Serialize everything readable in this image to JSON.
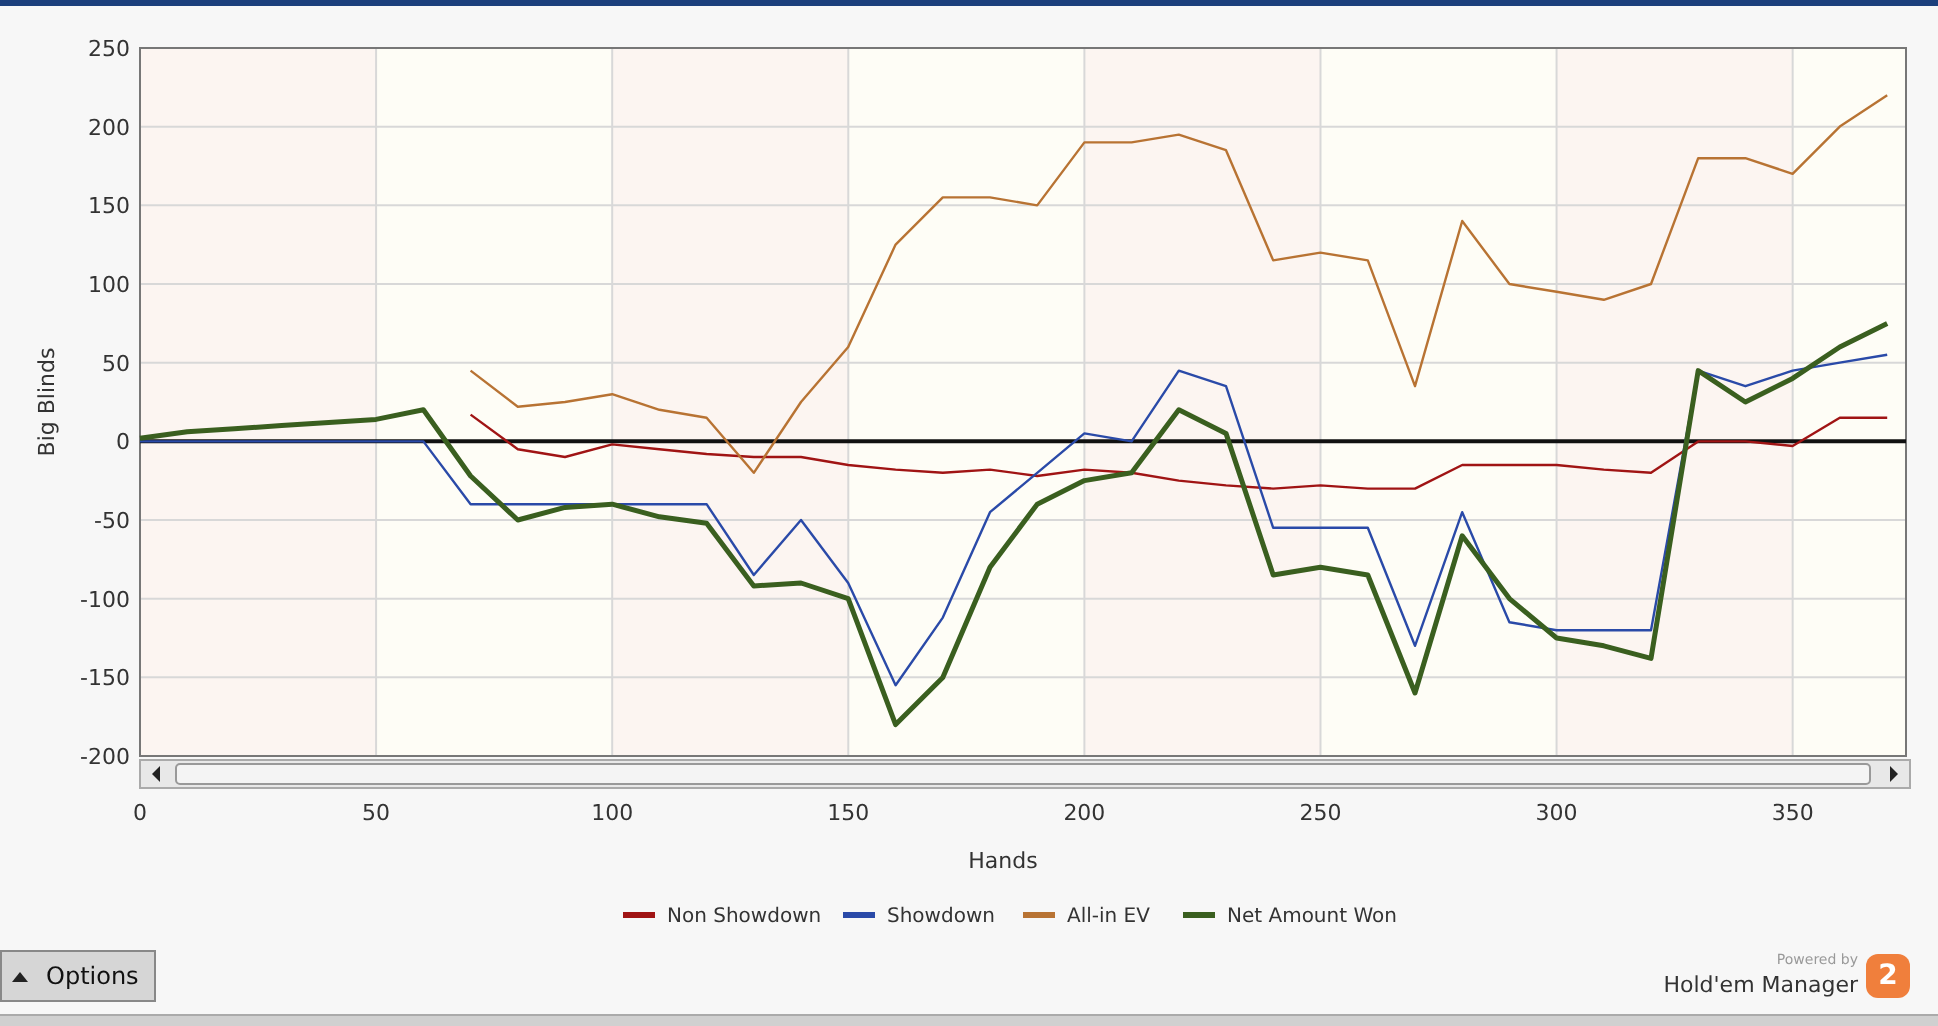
{
  "chart": {
    "chart_data": {
      "type": "line",
      "xlabel": "Hands",
      "ylabel": "Big Blinds",
      "grid": true,
      "legend": "bottom",
      "x": [
        0,
        10,
        20,
        30,
        40,
        50,
        60,
        70,
        80,
        90,
        100,
        110,
        120,
        130,
        140,
        150,
        160,
        170,
        180,
        190,
        200,
        210,
        220,
        230,
        240,
        250,
        260,
        270,
        280,
        290,
        300,
        310,
        320,
        330,
        340,
        350,
        360,
        370
      ],
      "series": [
        {
          "name": "Non Showdown",
          "color": "#a01414",
          "values": [
            null,
            null,
            null,
            null,
            null,
            null,
            null,
            17,
            -5,
            -10,
            -2,
            -5,
            -8,
            -10,
            -10,
            -15,
            -18,
            -20,
            -18,
            -22,
            -18,
            -20,
            -25,
            -28,
            -30,
            -28,
            -30,
            -30,
            -15,
            -15,
            -15,
            -18,
            -20,
            0,
            0,
            -3,
            15,
            15
          ]
        },
        {
          "name": "Showdown",
          "color": "#2a4aa8",
          "values": [
            0,
            0,
            0,
            0,
            0,
            0,
            0,
            -40,
            -40,
            -40,
            -40,
            -40,
            -40,
            -85,
            -50,
            -90,
            -155,
            -112,
            -45,
            -20,
            5,
            0,
            45,
            35,
            -55,
            -55,
            -55,
            -130,
            -45,
            -115,
            -120,
            -120,
            -120,
            45,
            35,
            45,
            50,
            55
          ]
        },
        {
          "name": "All-in EV",
          "color": "#b87333",
          "values": [
            null,
            null,
            null,
            null,
            null,
            null,
            null,
            45,
            22,
            25,
            30,
            20,
            15,
            -20,
            25,
            60,
            125,
            155,
            155,
            150,
            190,
            190,
            195,
            185,
            115,
            120,
            115,
            35,
            140,
            100,
            95,
            90,
            100,
            180,
            180,
            170,
            200,
            220
          ]
        },
        {
          "name": "Net Amount Won",
          "color": "#3a5f1f",
          "values": [
            2,
            6,
            8,
            10,
            12,
            14,
            20,
            -22,
            -50,
            -42,
            -40,
            -48,
            -52,
            -92,
            -90,
            -100,
            -180,
            -150,
            -80,
            -40,
            -25,
            -20,
            20,
            5,
            -85,
            -80,
            -85,
            -160,
            -60,
            -100,
            -125,
            -130,
            -138,
            45,
            25,
            40,
            60,
            75
          ]
        }
      ],
      "xlim": [
        0,
        374
      ],
      "ylim": [
        -200,
        250
      ],
      "xticks": [
        0,
        50,
        100,
        150,
        200,
        250,
        300,
        350
      ],
      "yticks": [
        -200,
        -150,
        -100,
        -50,
        0,
        50,
        100,
        150,
        200,
        250
      ]
    }
  },
  "options_button": {
    "label": "Options"
  },
  "branding": {
    "powered_by": "Powered by",
    "product": "Hold'em Manager",
    "badge": "2"
  }
}
